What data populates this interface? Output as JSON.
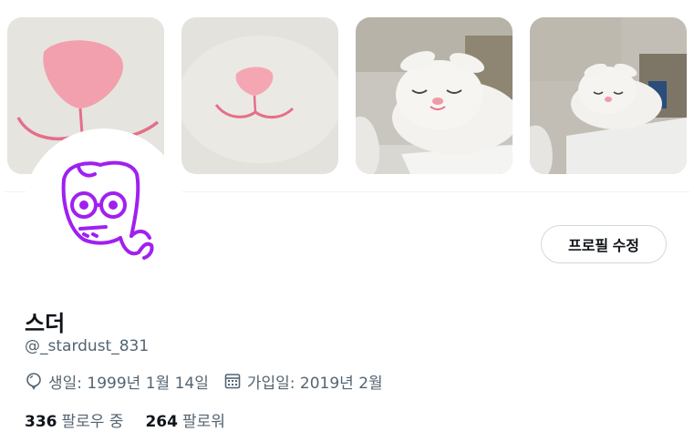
{
  "banner": {
    "photos": [
      {
        "icon": "plush-nose-closeup-photo"
      },
      {
        "icon": "plush-face-closeup-photo"
      },
      {
        "icon": "sleeping-bunny-plush-photo"
      },
      {
        "icon": "sleeping-bunny-plush-photo-far"
      }
    ]
  },
  "profile": {
    "avatar_icon": "doodle-avatar-icon",
    "edit_button_label": "프로필 수정",
    "display_name": "스더",
    "handle": "@_stardust_831",
    "birthday": "생일: 1999년 1월 14일",
    "joined": "가입일: 2019년 2월",
    "following_count": "336",
    "following_label": "팔로우 중",
    "followers_count": "264",
    "followers_label": "팔로워"
  },
  "colors": {
    "avatar_stroke": "#a020f0",
    "secondary_text": "#536471",
    "button_border": "#cfd9de",
    "plush_pink": "#f4a7b3"
  }
}
